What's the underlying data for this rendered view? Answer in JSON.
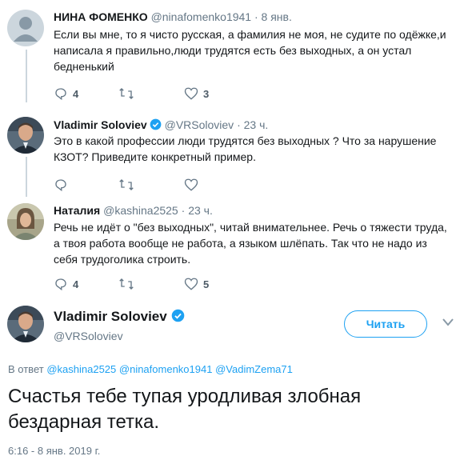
{
  "tweets": [
    {
      "name": "НИНА ФОМЕНКО",
      "handle": "@ninafomenko1941",
      "time": "8 янв.",
      "text": "Если вы мне, то я чисто русская, а фамилия не моя, не судите по одёжке,и написала я правильно,люди трудятся есть без выходных, а он устал бедненький",
      "replies": "4",
      "retweets": "",
      "likes": "3",
      "verified": false
    },
    {
      "name": "Vladimir Soloviev",
      "handle": "@VRSoloviev",
      "time": "23 ч.",
      "text": "Это в какой профессии люди трудятся без выходных ? Что за нарушение КЗОТ? Приведите конкретный пример.",
      "replies": "",
      "retweets": "",
      "likes": "",
      "verified": true
    },
    {
      "name": "Наталия",
      "handle": "@kashina2525",
      "time": "23 ч.",
      "text": "Речь не идёт о \"без выходных\", читай внимательнее. Речь о тяжести труда, а твоя работа вообще не работа, а языком шлёпать. Так что не надо из себя трудоголика строить.",
      "replies": "4",
      "retweets": "",
      "likes": "5",
      "verified": false
    }
  ],
  "separator": "·",
  "main": {
    "name": "Vladimir Soloviev",
    "handle": "@VRSoloviev",
    "follow_label": "Читать",
    "replying_prefix": "В ответ",
    "replying_to": [
      "@kashina2525",
      "@ninafomenko1941",
      "@VadimZema71"
    ],
    "text": "Счастья тебе тупая уродливая злобная бездарная тетка.",
    "timestamp": "6:16 - 8 янв. 2019 г."
  },
  "colors": {
    "accent": "#1da1f2",
    "secondary_text": "#657786",
    "thread_line": "#ccd6dd"
  },
  "icons": [
    "reply-icon",
    "retweet-icon",
    "like-icon",
    "verified-badge-icon",
    "chevron-down-icon"
  ]
}
